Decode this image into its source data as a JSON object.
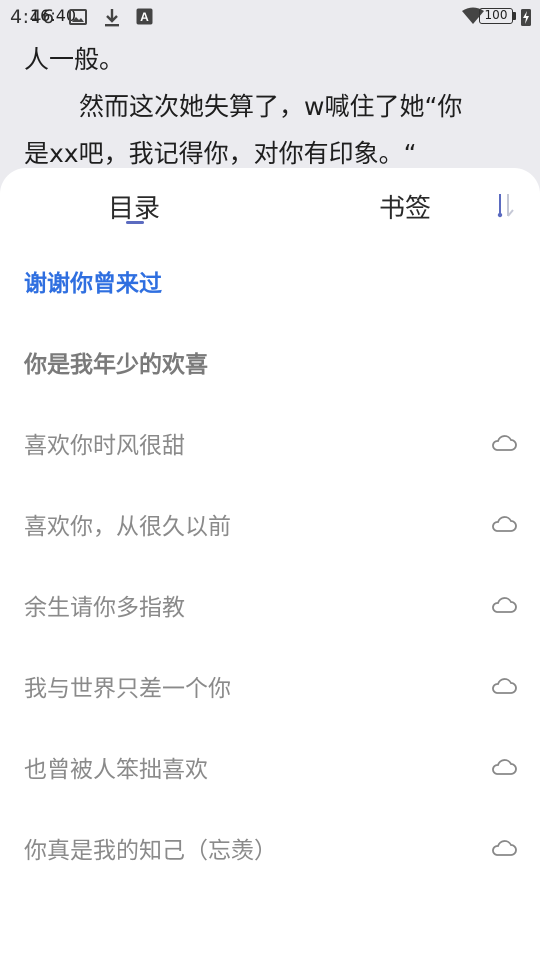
{
  "status_bar": {
    "time": "4:46",
    "time_ghost": "16:40",
    "battery": "100"
  },
  "reading_text": {
    "line1": "人一般。",
    "line2": "然而这次她失算了，w喊住了她“你",
    "line3": "是xx吧，我记得你，对你有印象。“"
  },
  "sheet": {
    "tabs": [
      {
        "label": "目录",
        "active": true
      },
      {
        "label": "书签",
        "active": false
      }
    ],
    "chapters": [
      {
        "title": "谢谢你曾来过",
        "state": "current"
      },
      {
        "title": "你是我年少的欢喜",
        "state": "read"
      },
      {
        "title": "喜欢你时风很甜",
        "state": "cloud"
      },
      {
        "title": "喜欢你，从很久以前",
        "state": "cloud"
      },
      {
        "title": "余生请你多指教",
        "state": "cloud"
      },
      {
        "title": "我与世界只差一个你",
        "state": "cloud"
      },
      {
        "title": "也曾被人笨拙喜欢",
        "state": "cloud"
      },
      {
        "title": "你真是我的知己（忘羡）",
        "state": "cloud"
      }
    ]
  },
  "colors": {
    "accent": "#2f6fe0",
    "tab_indicator": "#5b6bc0",
    "muted_text": "#8a8a8a",
    "background": "#ebebef"
  },
  "icons": {
    "cloud": "cloud-icon",
    "sort": "sort-icon",
    "wifi": "wifi-icon",
    "download": "download-icon",
    "image": "image-icon",
    "font": "font-a-icon"
  }
}
